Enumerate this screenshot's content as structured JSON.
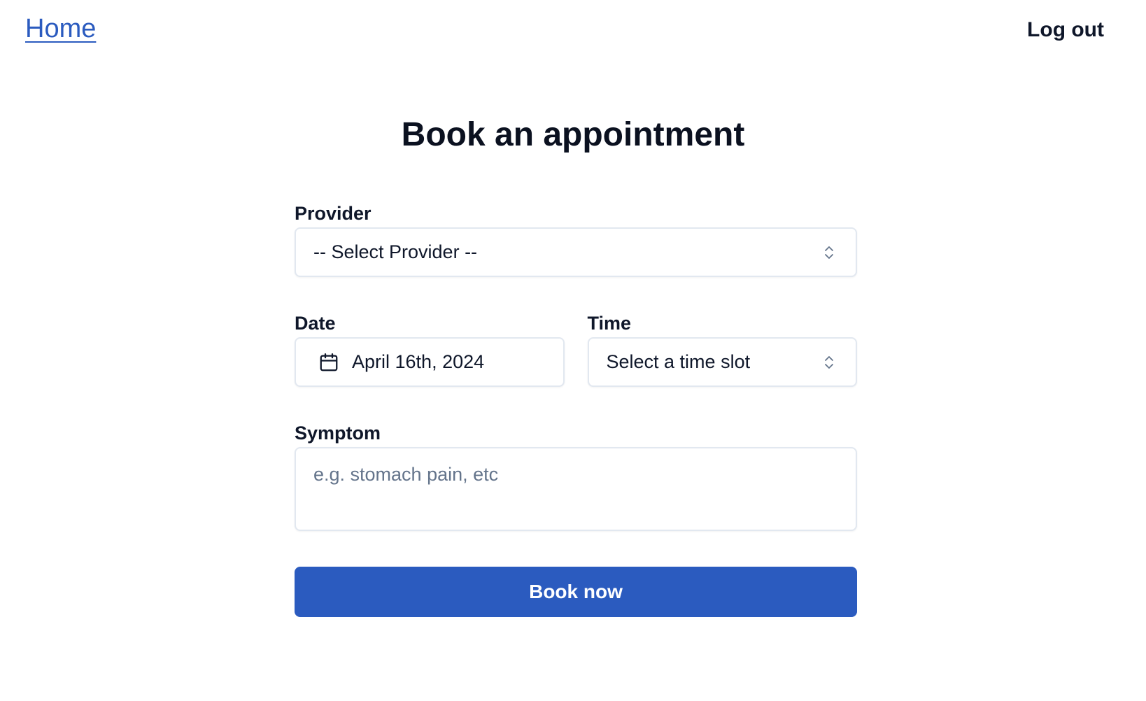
{
  "nav": {
    "home_label": "Home",
    "logout_label": "Log out"
  },
  "page": {
    "title": "Book an appointment"
  },
  "form": {
    "provider": {
      "label": "Provider",
      "value": "-- Select Provider --"
    },
    "date": {
      "label": "Date",
      "value": "April 16th, 2024",
      "icon": "calendar-icon"
    },
    "time": {
      "label": "Time",
      "value": "Select a time slot"
    },
    "symptom": {
      "label": "Symptom",
      "placeholder": "e.g. stomach pain, etc",
      "value": ""
    },
    "submit_label": "Book now"
  },
  "colors": {
    "primary": "#2b5bbf",
    "border": "#e2e8f0",
    "text": "#0f172a",
    "placeholder": "#64748b"
  }
}
